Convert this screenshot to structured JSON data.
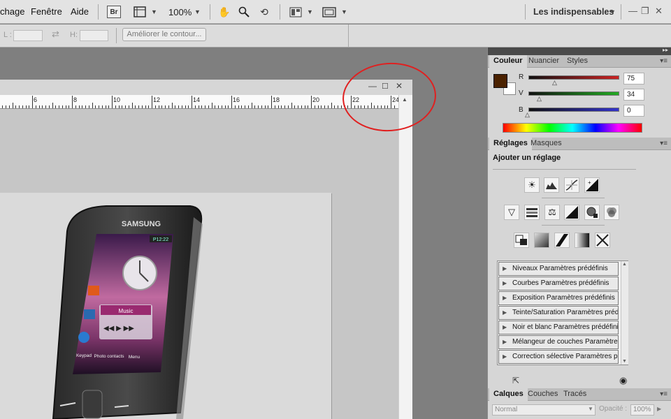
{
  "menubar": {
    "items": [
      "chage",
      "Fenêtre",
      "Aide"
    ],
    "bridge_label": "Br",
    "zoom": "100%",
    "workspace": "Les indispensables"
  },
  "options": {
    "l_label": "L :",
    "h_label": "H:",
    "refine_label": "Améliorer le contour..."
  },
  "ruler": {
    "labels": [
      "6",
      "8",
      "10",
      "12",
      "14",
      "16",
      "18",
      "20",
      "22",
      "24"
    ]
  },
  "color_panel": {
    "tabs": [
      "Couleur",
      "Nuancier",
      "Styles"
    ],
    "channels": [
      {
        "label": "R",
        "value": "75",
        "color": "#cc2222"
      },
      {
        "label": "V",
        "value": "34",
        "color": "#22aa22"
      },
      {
        "label": "B",
        "value": "0",
        "color": "#3333cc"
      }
    ],
    "foreground": "#4b2200",
    "background": "#ffffff"
  },
  "adjust_panel": {
    "tabs": [
      "Réglages",
      "Masques"
    ],
    "heading": "Ajouter un réglage",
    "presets": [
      "Niveaux Paramètres prédéfinis",
      "Courbes Paramètres prédéfinis",
      "Exposition Paramètres prédéfinis",
      "Teinte/Saturation Paramètres prédéfinis",
      "Noir et blanc Paramètres prédéfinis",
      "Mélangeur de couches Paramètres prédéfinis",
      "Correction sélective Paramètres prédéfinis"
    ]
  },
  "layers_panel": {
    "tabs": [
      "Calques",
      "Couches",
      "Tracés"
    ],
    "blend_mode": "Normal",
    "opacity_label": "Opacité :",
    "opacity_value": "100%"
  },
  "phone": {
    "brand": "SAMSUNG",
    "time": "P12:22",
    "music_label": "Music",
    "bottom_labels": [
      "Keypad",
      "Photo contacts",
      "Menu"
    ]
  }
}
